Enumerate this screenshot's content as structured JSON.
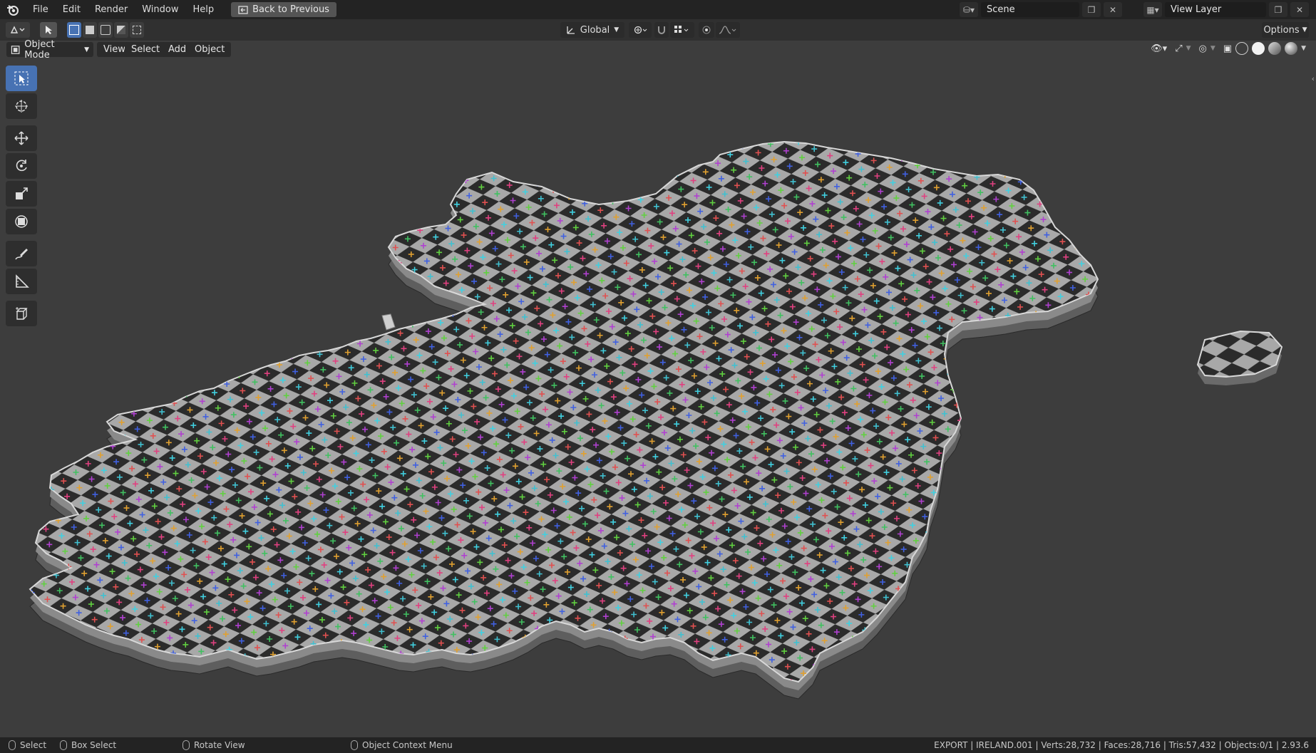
{
  "app": {
    "menus": [
      "File",
      "Edit",
      "Render",
      "Window",
      "Help"
    ],
    "back_label": "Back to Previous",
    "scene": "Scene",
    "view_layer": "View Layer"
  },
  "tool_header": {
    "orientation": "Global",
    "options_label": "Options"
  },
  "viewport_header": {
    "mode": "Object Mode",
    "menus": [
      "View",
      "Select",
      "Add",
      "Object"
    ]
  },
  "toolbar_tools": [
    "select-box",
    "cursor",
    "move",
    "rotate",
    "scale",
    "transform",
    "annotate",
    "measure",
    "add-cube"
  ],
  "status": {
    "hint1": "Select",
    "hint2": "Box Select",
    "hint3": "Rotate View",
    "hint4": "Object Context Menu",
    "stats": "EXPORT | IRELAND.001 | Verts:28,732 | Faces:28,716 | Tris:57,432 | Objects:0/1 | 2.93.6"
  },
  "colors": {
    "accent": "#4772b3",
    "checker_light": "#a8a8a8",
    "checker_dark": "#2b2b2b",
    "marks": [
      "#e0a030",
      "#40c060",
      "#40c0d0",
      "#4060e0",
      "#b040d0",
      "#e04080",
      "#e05050",
      "#60d040",
      "#40d0e0"
    ]
  }
}
